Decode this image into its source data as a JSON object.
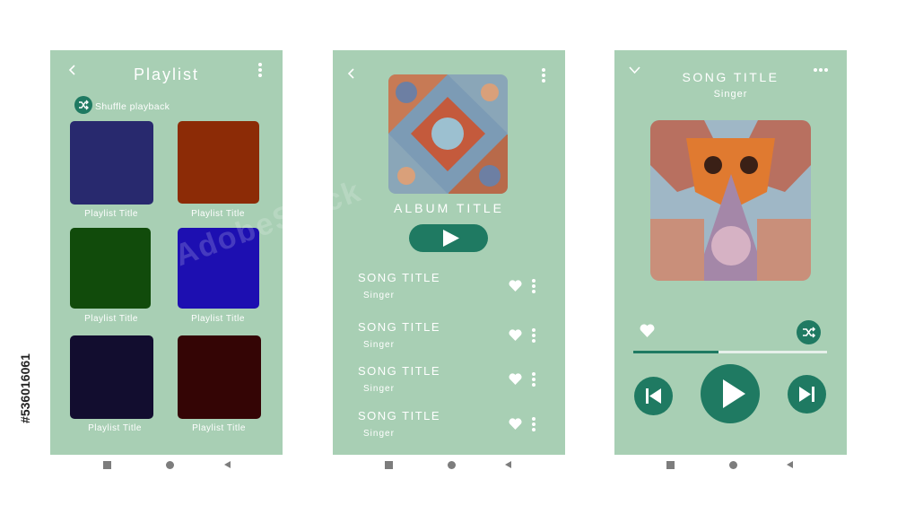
{
  "watermark": "AdobeStock",
  "stock_id": "#536016061",
  "playlist_screen": {
    "back_icon": "chevron-left-icon",
    "title": "Playlist",
    "menu_icon": "kebab-menu-icon",
    "shuffle_label": "Shuffle playback",
    "items": [
      {
        "label": "Playlist Title",
        "color": "#28296e"
      },
      {
        "label": "Playlist Title",
        "color": "#8c2b06"
      },
      {
        "label": "Playlist Title",
        "color": "#114b0b"
      },
      {
        "label": "Playlist Title",
        "color": "#1d0fb1"
      },
      {
        "label": "Playlist Title",
        "color": "#120d2f"
      },
      {
        "label": "Playlist Title",
        "color": "#340505"
      }
    ]
  },
  "album_screen": {
    "back_icon": "chevron-left-icon",
    "menu_icon": "kebab-menu-icon",
    "album_title": "ALBUM TITLE",
    "play_icon": "play-icon",
    "songs": [
      {
        "title": "SONG TITLE",
        "singer": "Singer"
      },
      {
        "title": "SONG TITLE",
        "singer": "Singer"
      },
      {
        "title": "SONG TITLE",
        "singer": "Singer"
      },
      {
        "title": "SONG TITLE",
        "singer": "Singer"
      }
    ]
  },
  "player_screen": {
    "collapse_icon": "chevron-down-icon",
    "menu_icon": "more-horizontal-icon",
    "song_title": "SONG TITLE",
    "singer": "Singer",
    "progress": 0.44,
    "colors": {
      "accent": "#1f7a62",
      "background": "#a8cfb4"
    }
  }
}
